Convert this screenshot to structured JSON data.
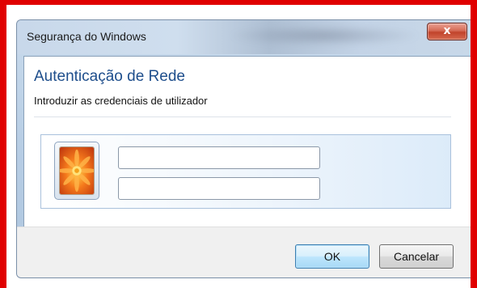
{
  "window": {
    "title": "Segurança do Windows",
    "close_label": "x"
  },
  "dialog": {
    "heading": "Autenticação de Rede",
    "subheading": "Introduzir as credenciais de utilizador"
  },
  "credentials": {
    "avatar_icon": "user-tile-flower-icon",
    "username_value": "",
    "password_value": ""
  },
  "buttons": {
    "ok_label": "OK",
    "cancel_label": "Cancelar"
  },
  "colors": {
    "highlight_border": "#e00000",
    "heading_blue": "#1e4e8c",
    "close_button_red": "#c1432b"
  }
}
